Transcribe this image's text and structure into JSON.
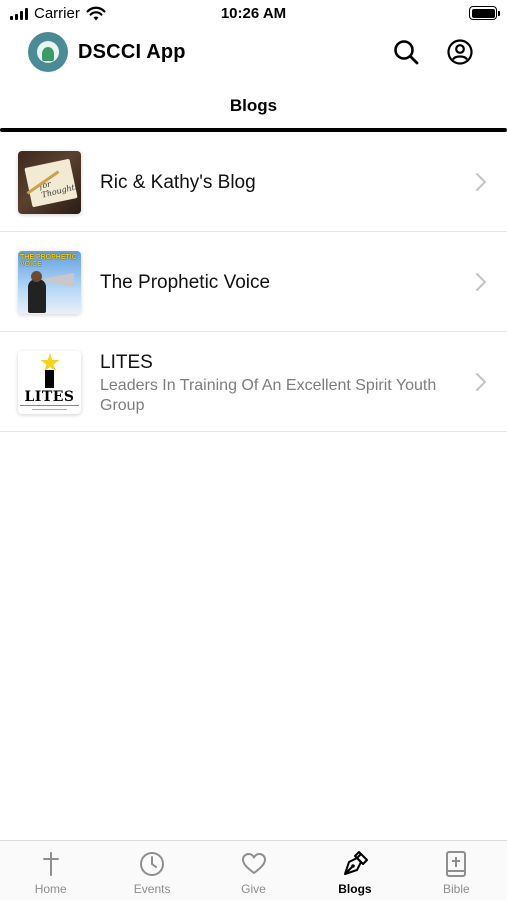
{
  "status_bar": {
    "carrier": "Carrier",
    "time": "10:26 AM"
  },
  "header": {
    "app_title": "DSCCI App",
    "logo_icon": "app-logo",
    "search_icon": "search-icon",
    "account_icon": "account-circle-icon"
  },
  "page": {
    "tab_title": "Blogs"
  },
  "blogs": [
    {
      "title": "Ric & Kathy's Blog",
      "subtitle": ""
    },
    {
      "title": "The Prophetic Voice",
      "subtitle": ""
    },
    {
      "title": "LITES",
      "subtitle": "Leaders In Training Of An Excellent Spirit Youth Group"
    }
  ],
  "thumb_text": {
    "ric": "for Thoughts",
    "prophetic": "THE PROPHETIC VOICE",
    "lites": "LITES"
  },
  "tab_bar": {
    "items": [
      {
        "label": "Home",
        "icon": "cross-icon",
        "active": false
      },
      {
        "label": "Events",
        "icon": "clock-icon",
        "active": false
      },
      {
        "label": "Give",
        "icon": "heart-icon",
        "active": false
      },
      {
        "label": "Blogs",
        "icon": "pen-nib-icon",
        "active": true
      },
      {
        "label": "Bible",
        "icon": "bible-icon",
        "active": false
      }
    ]
  },
  "colors": {
    "logo": "#4a8b95",
    "active_tab": "#000000",
    "inactive_tab": "#8e8e8e",
    "subtitle": "#7d7d7d"
  }
}
